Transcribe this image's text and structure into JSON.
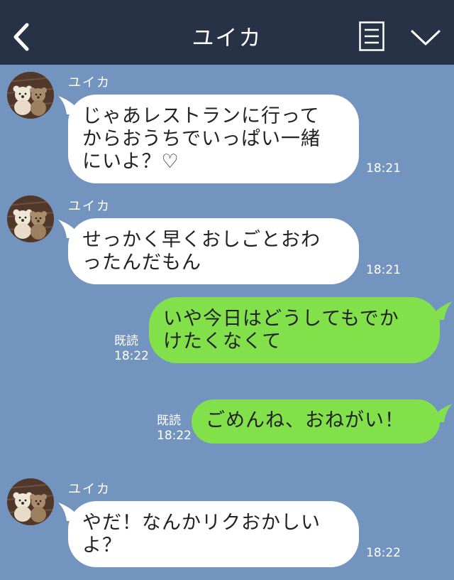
{
  "header": {
    "title": "ユイカ"
  },
  "messages": [
    {
      "sender": "ユイカ",
      "text_lines": [
        "じゃあレストランに行って",
        "からおうちでいっぱい一緒",
        "にいよ？♡"
      ],
      "time": "18:21"
    },
    {
      "sender": "ユイカ",
      "text_lines": [
        "せっかく早くおしごとおわ",
        "ったんだもん"
      ],
      "time": "18:21"
    },
    {
      "text_lines": [
        "いや今日はどうしてもでか",
        "けたくなくて"
      ],
      "read": "既読",
      "time": "18:22"
    },
    {
      "text_lines": [
        "ごめんね、おねがい！"
      ],
      "read": "既読",
      "time": "18:22"
    },
    {
      "sender": "ユイカ",
      "text_lines": [
        "やだ！なんかリクおかしい",
        "よ？"
      ],
      "time": "18:22"
    }
  ],
  "colors": {
    "header_bg": "#273246",
    "chat_bg": "#7494c0",
    "incoming_bubble": "#ffffff",
    "outgoing_bubble": "#82e14b"
  },
  "icons": {
    "back": "chevron-left-icon",
    "menu": "notes-icon",
    "collapse": "chevron-down-icon",
    "avatar": "teddy-bears-avatar"
  }
}
